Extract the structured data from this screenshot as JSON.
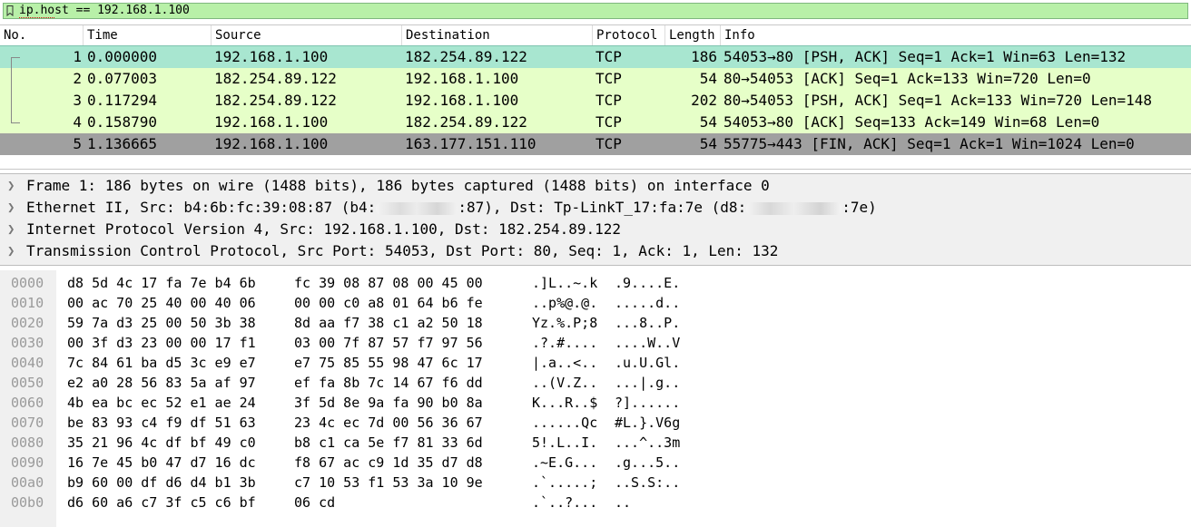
{
  "filter": {
    "text": "ip.host == 192.168.1.100",
    "bg_color": "#b8f0a8"
  },
  "packet_list": {
    "columns": [
      "No.",
      "Time",
      "Source",
      "Destination",
      "Protocol",
      "Length",
      "Info"
    ],
    "rows": [
      {
        "no": "1",
        "time": "0.000000",
        "src": "192.168.1.100",
        "dst": "182.254.89.122",
        "proto": "TCP",
        "len": "186",
        "info": "54053→80 [PSH, ACK] Seq=1 Ack=1 Win=63 Len=132",
        "state": "selected"
      },
      {
        "no": "2",
        "time": "0.077003",
        "src": "182.254.89.122",
        "dst": "192.168.1.100",
        "proto": "TCP",
        "len": "54",
        "info": "80→54053 [ACK] Seq=1 Ack=133 Win=720 Len=0",
        "state": "normal"
      },
      {
        "no": "3",
        "time": "0.117294",
        "src": "182.254.89.122",
        "dst": "192.168.1.100",
        "proto": "TCP",
        "len": "202",
        "info": "80→54053 [PSH, ACK] Seq=1 Ack=133 Win=720 Len=148",
        "state": "normal"
      },
      {
        "no": "4",
        "time": "0.158790",
        "src": "192.168.1.100",
        "dst": "182.254.89.122",
        "proto": "TCP",
        "len": "54",
        "info": "54053→80 [ACK] Seq=133 Ack=149 Win=68 Len=0",
        "state": "normal"
      },
      {
        "no": "5",
        "time": "1.136665",
        "src": "192.168.1.100",
        "dst": "163.177.151.110",
        "proto": "TCP",
        "len": "54",
        "info": "55775→443 [FIN, ACK] Seq=1 Ack=1 Win=1024 Len=0",
        "state": "fin"
      }
    ],
    "colors": {
      "normal": "#e6ffc8",
      "selected": "#a8e6d0",
      "fin": "#a0a0a0"
    }
  },
  "details": {
    "items": [
      {
        "segments": [
          "Frame 1: 186 bytes on wire (1488 bits), 186 bytes captured (1488 bits) on interface 0"
        ]
      },
      {
        "segments": [
          "Ethernet II, Src: b4:6b:fc:39:08:87 (b4:",
          ":87), Dst: Tp-LinkT_17:fa:7e (d8:",
          ":7e)"
        ]
      },
      {
        "segments": [
          "Internet Protocol Version 4, Src: 192.168.1.100, Dst: 182.254.89.122"
        ]
      },
      {
        "segments": [
          "Transmission Control Protocol, Src Port: 54053, Dst Port: 80, Seq: 1, Ack: 1, Len: 132"
        ]
      }
    ]
  },
  "hex": {
    "rows": [
      {
        "off": "0000",
        "b1": "d8 5d 4c 17 fa 7e b4 6b",
        "b2": "fc 39 08 87 08 00 45 00",
        "a1": ".]L..~.k",
        "a2": ".9....E."
      },
      {
        "off": "0010",
        "b1": "00 ac 70 25 40 00 40 06",
        "b2": "00 00 c0 a8 01 64 b6 fe",
        "a1": "..p%@.@.",
        "a2": ".....d.."
      },
      {
        "off": "0020",
        "b1": "59 7a d3 25 00 50 3b 38",
        "b2": "8d aa f7 38 c1 a2 50 18",
        "a1": "Yz.%.P;8",
        "a2": "...8..P."
      },
      {
        "off": "0030",
        "b1": "00 3f d3 23 00 00 17 f1",
        "b2": "03 00 7f 87 57 f7 97 56",
        "a1": ".?.#....",
        "a2": "....W..V"
      },
      {
        "off": "0040",
        "b1": "7c 84 61 ba d5 3c e9 e7",
        "b2": "e7 75 85 55 98 47 6c 17",
        "a1": "|.a..<..",
        "a2": ".u.U.Gl."
      },
      {
        "off": "0050",
        "b1": "e2 a0 28 56 83 5a af 97",
        "b2": "ef fa 8b 7c 14 67 f6 dd",
        "a1": "..(V.Z..",
        "a2": "...|.g.."
      },
      {
        "off": "0060",
        "b1": "4b ea bc ec 52 e1 ae 24",
        "b2": "3f 5d 8e 9a fa 90 b0 8a",
        "a1": "K...R..$",
        "a2": "?]......"
      },
      {
        "off": "0070",
        "b1": "be 83 93 c4 f9 df 51 63",
        "b2": "23 4c ec 7d 00 56 36 67",
        "a1": "......Qc",
        "a2": "#L.}.V6g"
      },
      {
        "off": "0080",
        "b1": "35 21 96 4c df bf 49 c0",
        "b2": "b8 c1 ca 5e f7 81 33 6d",
        "a1": "5!.L..I.",
        "a2": "...^..3m"
      },
      {
        "off": "0090",
        "b1": "16 7e 45 b0 47 d7 16 dc",
        "b2": "f8 67 ac c9 1d 35 d7 d8",
        "a1": ".~E.G...",
        "a2": ".g...5.."
      },
      {
        "off": "00a0",
        "b1": "b9 60 00 df d6 d4 b1 3b",
        "b2": "c7 10 53 f1 53 3a 10 9e",
        "a1": ".`.....;",
        "a2": "..S.S:.."
      },
      {
        "off": "00b0",
        "b1": "d6 60 a6 c7 3f c5 c6 bf",
        "b2": "06 cd",
        "a1": ".`..?...",
        "a2": ".."
      }
    ]
  }
}
